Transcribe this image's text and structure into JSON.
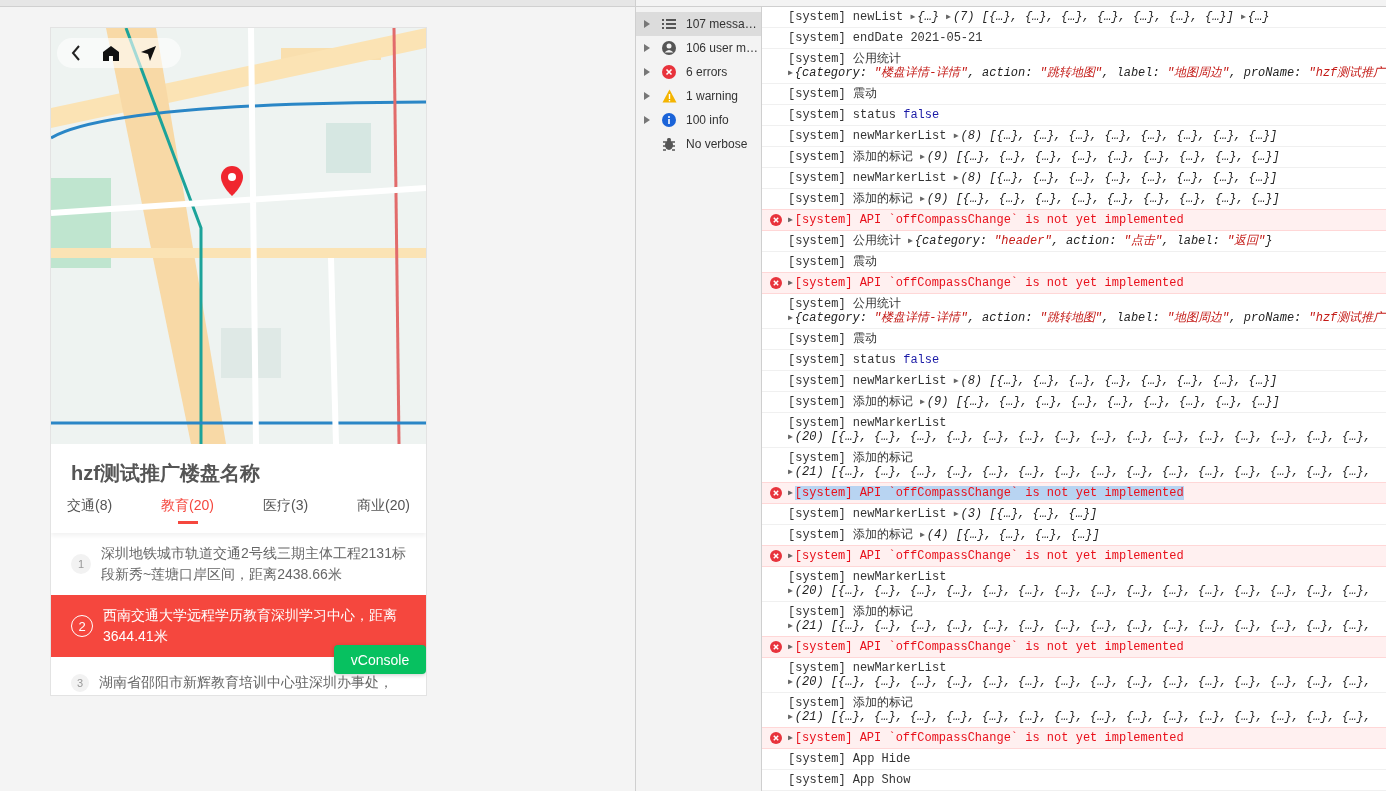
{
  "phone": {
    "title": "hzf测试推广楼盘名称",
    "tabs": [
      {
        "label": "交通(8)",
        "selected": false
      },
      {
        "label": "教育(20)",
        "selected": true
      },
      {
        "label": "医疗(3)",
        "selected": false
      },
      {
        "label": "商业(20)",
        "selected": false
      }
    ],
    "places": [
      {
        "number": "1",
        "text": "深圳地铁城市轨道交通2号线三期主体工程2131标段新秀~莲塘口岸区间，距离2438.66米",
        "selected": false
      },
      {
        "number": "2",
        "text": "西南交通大学远程学历教育深圳学习中心，距离3644.41米",
        "selected": true
      },
      {
        "number": "3",
        "text": "湖南省邵阳市新辉教育培训中心驻深圳办事处，",
        "selected": false
      }
    ],
    "vconsole_button": "vConsole"
  },
  "devtools": {
    "sidebar": [
      {
        "label": "107 messa…",
        "kind": "messages",
        "selected": true,
        "expanded": false
      },
      {
        "label": "106 user m…",
        "kind": "user",
        "selected": false,
        "expanded": false
      },
      {
        "label": "6 errors",
        "kind": "errors",
        "selected": false,
        "expanded": false
      },
      {
        "label": "1 warning",
        "kind": "warnings",
        "selected": false,
        "expanded": false
      },
      {
        "label": "100 info",
        "kind": "info",
        "selected": false,
        "expanded": false
      },
      {
        "label": "No verbose",
        "kind": "verbose",
        "selected": false
      }
    ],
    "rows": [
      {
        "kind": "log",
        "highlighted": false,
        "lines": [
          [
            {
              "kind": "plain",
              "text": "[system] newList "
            },
            {
              "kind": "toggle",
              "text": "▶"
            },
            {
              "kind": "italic",
              "text": "{…} "
            },
            {
              "kind": "toggle",
              "text": "▶"
            },
            {
              "kind": "italic",
              "text": "(7) [{…}, {…}, {…}, {…}, {…}, {…}, {…}] "
            },
            {
              "kind": "toggle",
              "text": "▶"
            },
            {
              "kind": "italic",
              "text": "{…}"
            }
          ]
        ]
      },
      {
        "kind": "log",
        "highlighted": false,
        "lines": [
          [
            {
              "kind": "plain",
              "text": "[system] endDate 2021-05-21"
            }
          ]
        ]
      },
      {
        "kind": "log",
        "highlighted": false,
        "lines": [
          [
            {
              "kind": "plain",
              "text": "[system] 公用统计"
            }
          ],
          [
            {
              "kind": "toggle",
              "text": "▶"
            },
            {
              "kind": "italic",
              "text": "{category: "
            },
            {
              "kind": "string",
              "text": "\"楼盘详情-详情\""
            },
            {
              "kind": "italic",
              "text": ", action: "
            },
            {
              "kind": "string",
              "text": "\"跳转地图\""
            },
            {
              "kind": "italic",
              "text": ", label: "
            },
            {
              "kind": "string",
              "text": "\"地图周边\""
            },
            {
              "kind": "italic",
              "text": ", proName: "
            },
            {
              "kind": "string",
              "text": "\"hzf测试推广"
            }
          ]
        ]
      },
      {
        "kind": "log",
        "highlighted": false,
        "lines": [
          [
            {
              "kind": "plain",
              "text": "[system] 震动"
            }
          ]
        ]
      },
      {
        "kind": "log",
        "highlighted": false,
        "lines": [
          [
            {
              "kind": "plain",
              "text": "[system] status "
            },
            {
              "kind": "keyword",
              "text": "false"
            }
          ]
        ]
      },
      {
        "kind": "log",
        "highlighted": false,
        "lines": [
          [
            {
              "kind": "plain",
              "text": "[system] newMarkerList "
            },
            {
              "kind": "toggle",
              "text": "▶"
            },
            {
              "kind": "italic",
              "text": "(8) [{…}, {…}, {…}, {…}, {…}, {…}, {…}, {…}]"
            }
          ]
        ]
      },
      {
        "kind": "log",
        "highlighted": false,
        "lines": [
          [
            {
              "kind": "plain",
              "text": "[system] 添加的标记 "
            },
            {
              "kind": "toggle",
              "text": "▶"
            },
            {
              "kind": "italic",
              "text": "(9) [{…}, {…}, {…}, {…}, {…}, {…}, {…}, {…}, {…}]"
            }
          ]
        ]
      },
      {
        "kind": "log",
        "highlighted": false,
        "lines": [
          [
            {
              "kind": "plain",
              "text": "[system] newMarkerList "
            },
            {
              "kind": "toggle",
              "text": "▶"
            },
            {
              "kind": "italic",
              "text": "(8) [{…}, {…}, {…}, {…}, {…}, {…}, {…}, {…}]"
            }
          ]
        ]
      },
      {
        "kind": "log",
        "highlighted": false,
        "lines": [
          [
            {
              "kind": "plain",
              "text": "[system] 添加的标记 "
            },
            {
              "kind": "toggle",
              "text": "▶"
            },
            {
              "kind": "italic",
              "text": "(9) [{…}, {…}, {…}, {…}, {…}, {…}, {…}, {…}, {…}]"
            }
          ]
        ]
      },
      {
        "kind": "error",
        "highlighted": false,
        "lines": [
          [
            {
              "kind": "toggle",
              "text": "▶"
            },
            {
              "kind": "error",
              "text": "[system] API `offCompassChange` is not yet implemented"
            }
          ]
        ]
      },
      {
        "kind": "log",
        "highlighted": false,
        "lines": [
          [
            {
              "kind": "plain",
              "text": "[system] 公用统计 "
            },
            {
              "kind": "toggle",
              "text": "▶"
            },
            {
              "kind": "italic",
              "text": "{category: "
            },
            {
              "kind": "string",
              "text": "\"header\""
            },
            {
              "kind": "italic",
              "text": ", action: "
            },
            {
              "kind": "string",
              "text": "\"点击\""
            },
            {
              "kind": "italic",
              "text": ", label: "
            },
            {
              "kind": "string",
              "text": "\"返回\""
            },
            {
              "kind": "italic",
              "text": "}"
            }
          ]
        ]
      },
      {
        "kind": "log",
        "highlighted": false,
        "lines": [
          [
            {
              "kind": "plain",
              "text": "[system] 震动"
            }
          ]
        ]
      },
      {
        "kind": "error",
        "highlighted": false,
        "lines": [
          [
            {
              "kind": "toggle",
              "text": "▶"
            },
            {
              "kind": "error",
              "text": "[system] API `offCompassChange` is not yet implemented"
            }
          ]
        ]
      },
      {
        "kind": "log",
        "highlighted": false,
        "lines": [
          [
            {
              "kind": "plain",
              "text": "[system] 公用统计"
            }
          ],
          [
            {
              "kind": "toggle",
              "text": "▶"
            },
            {
              "kind": "italic",
              "text": "{category: "
            },
            {
              "kind": "string",
              "text": "\"楼盘详情-详情\""
            },
            {
              "kind": "italic",
              "text": ", action: "
            },
            {
              "kind": "string",
              "text": "\"跳转地图\""
            },
            {
              "kind": "italic",
              "text": ", label: "
            },
            {
              "kind": "string",
              "text": "\"地图周边\""
            },
            {
              "kind": "italic",
              "text": ", proName: "
            },
            {
              "kind": "string",
              "text": "\"hzf测试推广"
            }
          ]
        ]
      },
      {
        "kind": "log",
        "highlighted": false,
        "lines": [
          [
            {
              "kind": "plain",
              "text": "[system] 震动"
            }
          ]
        ]
      },
      {
        "kind": "log",
        "highlighted": false,
        "lines": [
          [
            {
              "kind": "plain",
              "text": "[system] status "
            },
            {
              "kind": "keyword",
              "text": "false"
            }
          ]
        ]
      },
      {
        "kind": "log",
        "highlighted": false,
        "lines": [
          [
            {
              "kind": "plain",
              "text": "[system] newMarkerList "
            },
            {
              "kind": "toggle",
              "text": "▶"
            },
            {
              "kind": "italic",
              "text": "(8) [{…}, {…}, {…}, {…}, {…}, {…}, {…}, {…}]"
            }
          ]
        ]
      },
      {
        "kind": "log",
        "highlighted": false,
        "lines": [
          [
            {
              "kind": "plain",
              "text": "[system] 添加的标记 "
            },
            {
              "kind": "toggle",
              "text": "▶"
            },
            {
              "kind": "italic",
              "text": "(9) [{…}, {…}, {…}, {…}, {…}, {…}, {…}, {…}, {…}]"
            }
          ]
        ]
      },
      {
        "kind": "log",
        "highlighted": false,
        "lines": [
          [
            {
              "kind": "plain",
              "text": "[system] newMarkerList"
            }
          ],
          [
            {
              "kind": "toggle",
              "text": "▶"
            },
            {
              "kind": "italic",
              "text": "(20) [{…}, {…}, {…}, {…}, {…}, {…}, {…}, {…}, {…}, {…}, {…}, {…}, {…}, {…}, {…},"
            }
          ]
        ]
      },
      {
        "kind": "log",
        "highlighted": false,
        "lines": [
          [
            {
              "kind": "plain",
              "text": "[system] 添加的标记"
            }
          ],
          [
            {
              "kind": "toggle",
              "text": "▶"
            },
            {
              "kind": "italic",
              "text": "(21) [{…}, {…}, {…}, {…}, {…}, {…}, {…}, {…}, {…}, {…}, {…}, {…}, {…}, {…}, {…},"
            }
          ]
        ]
      },
      {
        "kind": "error",
        "highlighted": true,
        "lines": [
          [
            {
              "kind": "toggle",
              "text": "▶"
            },
            {
              "kind": "error",
              "text": "[system] API `offCompassChange` is not yet implemented"
            }
          ]
        ]
      },
      {
        "kind": "log",
        "highlighted": false,
        "lines": [
          [
            {
              "kind": "plain",
              "text": "[system] newMarkerList "
            },
            {
              "kind": "toggle",
              "text": "▶"
            },
            {
              "kind": "italic",
              "text": "(3) [{…}, {…}, {…}]"
            }
          ]
        ]
      },
      {
        "kind": "log",
        "highlighted": false,
        "lines": [
          [
            {
              "kind": "plain",
              "text": "[system] 添加的标记 "
            },
            {
              "kind": "toggle",
              "text": "▶"
            },
            {
              "kind": "italic",
              "text": "(4) [{…}, {…}, {…}, {…}]"
            }
          ]
        ]
      },
      {
        "kind": "error",
        "highlighted": false,
        "lines": [
          [
            {
              "kind": "toggle",
              "text": "▶"
            },
            {
              "kind": "error",
              "text": "[system] API `offCompassChange` is not yet implemented"
            }
          ]
        ]
      },
      {
        "kind": "log",
        "highlighted": false,
        "lines": [
          [
            {
              "kind": "plain",
              "text": "[system] newMarkerList"
            }
          ],
          [
            {
              "kind": "toggle",
              "text": "▶"
            },
            {
              "kind": "italic",
              "text": "(20) [{…}, {…}, {…}, {…}, {…}, {…}, {…}, {…}, {…}, {…}, {…}, {…}, {…}, {…}, {…},"
            }
          ]
        ]
      },
      {
        "kind": "log",
        "highlighted": false,
        "lines": [
          [
            {
              "kind": "plain",
              "text": "[system] 添加的标记"
            }
          ],
          [
            {
              "kind": "toggle",
              "text": "▶"
            },
            {
              "kind": "italic",
              "text": "(21) [{…}, {…}, {…}, {…}, {…}, {…}, {…}, {…}, {…}, {…}, {…}, {…}, {…}, {…}, {…},"
            }
          ]
        ]
      },
      {
        "kind": "error",
        "highlighted": false,
        "lines": [
          [
            {
              "kind": "toggle",
              "text": "▶"
            },
            {
              "kind": "error",
              "text": "[system] API `offCompassChange` is not yet implemented"
            }
          ]
        ]
      },
      {
        "kind": "log",
        "highlighted": false,
        "lines": [
          [
            {
              "kind": "plain",
              "text": "[system] newMarkerList"
            }
          ],
          [
            {
              "kind": "toggle",
              "text": "▶"
            },
            {
              "kind": "italic",
              "text": "(20) [{…}, {…}, {…}, {…}, {…}, {…}, {…}, {…}, {…}, {…}, {…}, {…}, {…}, {…}, {…},"
            }
          ]
        ]
      },
      {
        "kind": "log",
        "highlighted": false,
        "lines": [
          [
            {
              "kind": "plain",
              "text": "[system] 添加的标记"
            }
          ],
          [
            {
              "kind": "toggle",
              "text": "▶"
            },
            {
              "kind": "italic",
              "text": "(21) [{…}, {…}, {…}, {…}, {…}, {…}, {…}, {…}, {…}, {…}, {…}, {…}, {…}, {…}, {…},"
            }
          ]
        ]
      },
      {
        "kind": "error",
        "highlighted": false,
        "lines": [
          [
            {
              "kind": "toggle",
              "text": "▶"
            },
            {
              "kind": "error",
              "text": "[system] API `offCompassChange` is not yet implemented"
            }
          ]
        ]
      },
      {
        "kind": "log",
        "highlighted": false,
        "lines": [
          [
            {
              "kind": "plain",
              "text": "[system] App Hide"
            }
          ]
        ]
      },
      {
        "kind": "log",
        "highlighted": false,
        "lines": [
          [
            {
              "kind": "plain",
              "text": "[system] App Show"
            }
          ]
        ]
      }
    ]
  }
}
